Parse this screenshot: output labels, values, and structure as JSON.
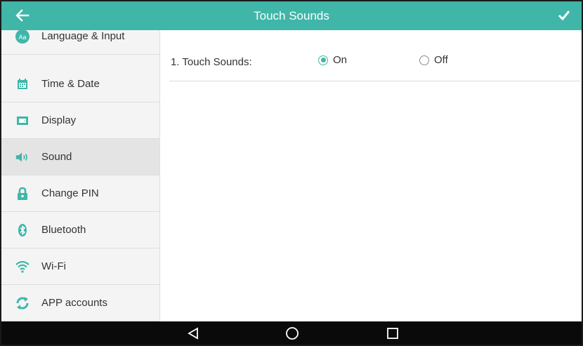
{
  "header": {
    "title": "Touch Sounds",
    "back_icon": "arrow-left-icon",
    "confirm_icon": "checkmark-icon"
  },
  "sidebar": {
    "items": [
      {
        "label": "Language & Input",
        "icon": "language-icon",
        "active": false
      },
      {
        "label": "Time & Date",
        "icon": "calendar-icon",
        "active": false
      },
      {
        "label": "Display",
        "icon": "display-icon",
        "active": false
      },
      {
        "label": "Sound",
        "icon": "speaker-icon",
        "active": true
      },
      {
        "label": "Change PIN",
        "icon": "lock-icon",
        "active": false
      },
      {
        "label": "Bluetooth",
        "icon": "bluetooth-icon",
        "active": false
      },
      {
        "label": "Wi-Fi",
        "icon": "wifi-icon",
        "active": false
      },
      {
        "label": "APP accounts",
        "icon": "sync-icon",
        "active": false
      }
    ]
  },
  "settings": {
    "touch_sounds": {
      "label": "1. Touch Sounds:",
      "options": [
        "On",
        "Off"
      ],
      "selected": "On"
    }
  },
  "navbar": {
    "icons": [
      "back-triangle-icon",
      "home-circle-icon",
      "recents-square-icon"
    ]
  },
  "colors": {
    "accent": "#3fb6a8",
    "sidebar_bg": "#f4f4f4",
    "active_bg": "#e4e4e4",
    "navbar_bg": "#0a0a0a"
  }
}
